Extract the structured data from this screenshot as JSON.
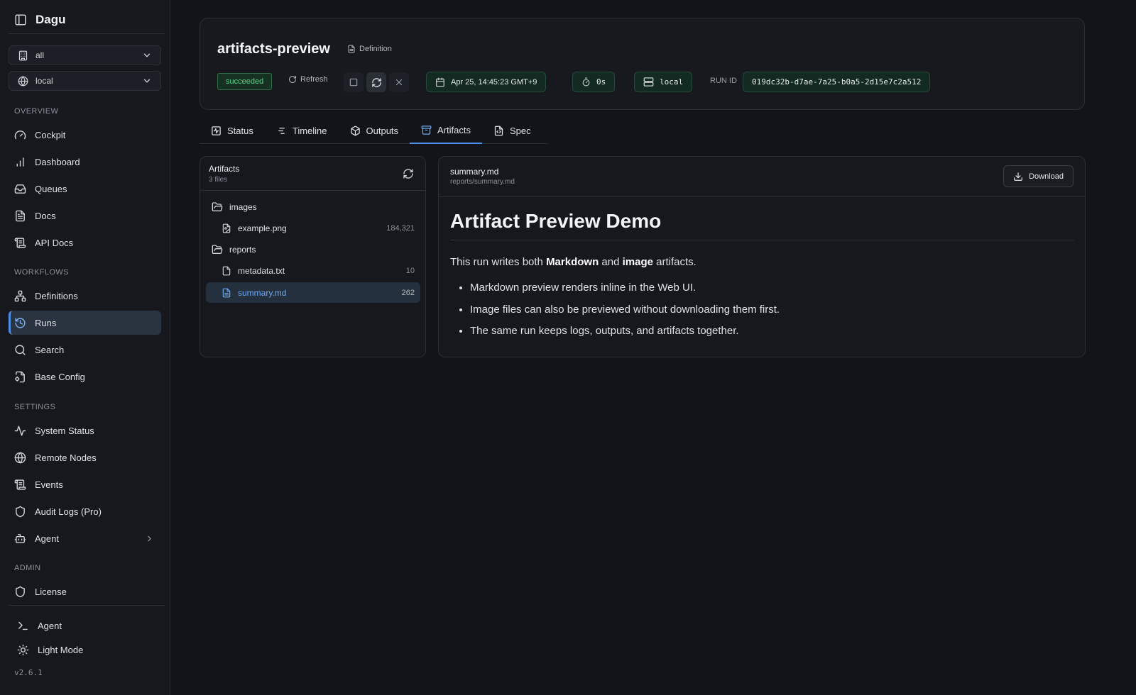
{
  "sidebar": {
    "brand": "Dagu",
    "namespace_select": "all",
    "node_select": "local",
    "sections": {
      "overview": "OVERVIEW",
      "workflows": "WORKFLOWS",
      "settings": "SETTINGS",
      "admin": "ADMIN"
    },
    "items": {
      "cockpit": "Cockpit",
      "dashboard": "Dashboard",
      "queues": "Queues",
      "docs": "Docs",
      "api_docs": "API Docs",
      "definitions": "Definitions",
      "runs": "Runs",
      "search": "Search",
      "base_config": "Base Config",
      "system_status": "System Status",
      "remote_nodes": "Remote Nodes",
      "events": "Events",
      "audit_logs": "Audit Logs (Pro)",
      "agent": "Agent",
      "license": "License"
    },
    "footer": {
      "agent": "Agent",
      "theme": "Light Mode",
      "version": "v2.6.1"
    },
    "active_item": "Runs"
  },
  "header": {
    "title": "artifacts-preview",
    "definition_link": "Definition",
    "status": "succeeded",
    "refresh": "Refresh",
    "started_at": "Apr 25, 14:45:23 GMT+9",
    "duration": "0s",
    "worker": "local",
    "run_id_label": "RUN ID",
    "run_id": "019dc32b-d7ae-7a25-b0a5-2d15e7c2a512"
  },
  "tabs": [
    "Status",
    "Timeline",
    "Outputs",
    "Artifacts",
    "Spec"
  ],
  "active_tab": "Artifacts",
  "artifacts": {
    "title": "Artifacts",
    "count": "3 files",
    "tree": [
      {
        "type": "folder",
        "name": "images"
      },
      {
        "type": "image",
        "name": "example.png",
        "size": "184,321"
      },
      {
        "type": "folder",
        "name": "reports"
      },
      {
        "type": "file",
        "name": "metadata.txt",
        "size": "10"
      },
      {
        "type": "doc",
        "name": "summary.md",
        "size": "262",
        "selected": true
      }
    ]
  },
  "preview": {
    "file_name": "summary.md",
    "file_path": "reports/summary.md",
    "download": "Download",
    "heading": "Artifact Preview Demo",
    "para_1": "This run writes both ",
    "para_bold_1": "Markdown",
    "para_2": " and ",
    "para_bold_2": "image",
    "para_3": " artifacts.",
    "bullets": [
      "Markdown preview renders inline in the Web UI.",
      "Image files can also be previewed without downloading them first.",
      "The same run keeps logs, outputs, and artifacts together."
    ]
  },
  "colors": {
    "accent": "#4d8ee8",
    "success": "#5bd48a",
    "background": "#121419"
  }
}
